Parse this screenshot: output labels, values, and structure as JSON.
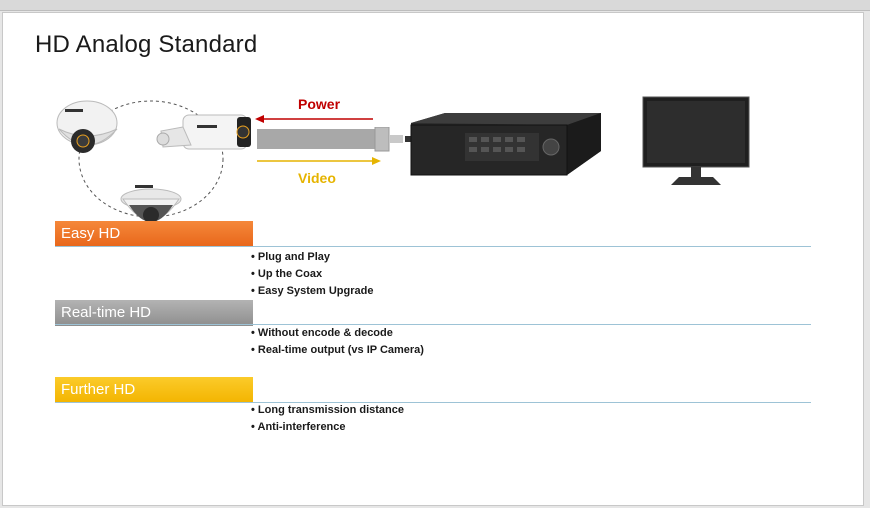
{
  "slide": {
    "title": "HD Analog Standard"
  },
  "diagram": {
    "power_label": "Power",
    "video_label": "Video",
    "colors": {
      "power": "#c00000",
      "video": "#e6b400"
    }
  },
  "sections": [
    {
      "label": "Easy HD",
      "color": "#ee6f22",
      "bullets": [
        "• Plug and Play",
        "• Up the Coax",
        "• Easy System Upgrade"
      ]
    },
    {
      "label": "Real-time HD",
      "color": "#9e9e9e",
      "bullets": [
        "• Without encode & decode",
        "• Real-time output (vs IP Camera)"
      ]
    },
    {
      "label": "Further HD",
      "color": "#f6bc08",
      "bullets": [
        "• Long transmission distance",
        "• Anti-interference"
      ]
    }
  ]
}
